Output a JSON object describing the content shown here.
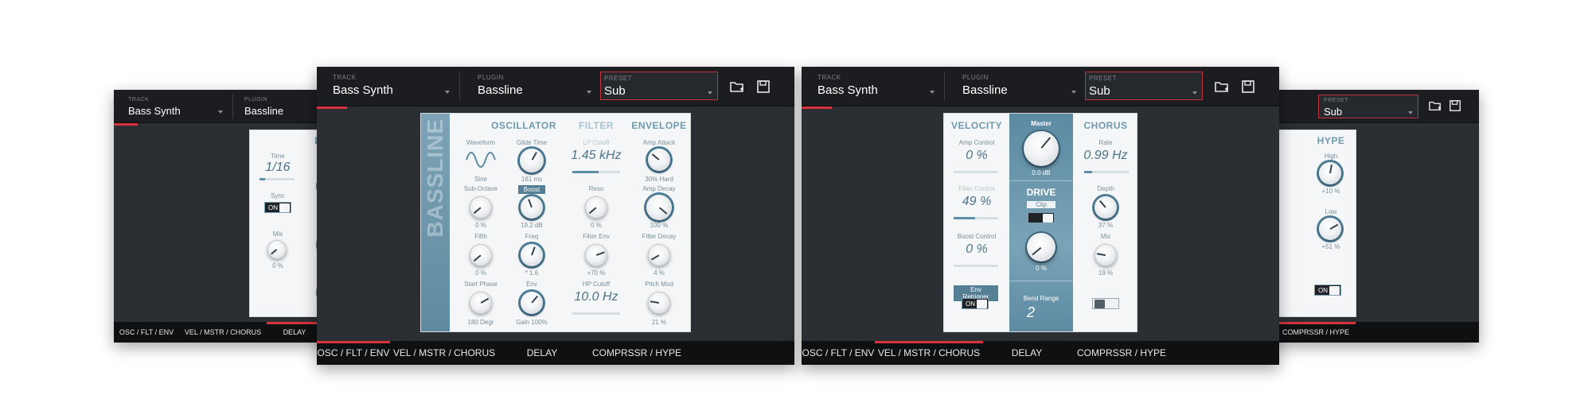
{
  "common": {
    "track_label": "TRACK",
    "plugin_label": "PLUGIN",
    "preset_label": "PRESET",
    "track_value": "Bass Synth",
    "plugin_value": "Bassline",
    "preset_value": "Sub",
    "accent_color": "#d8323c",
    "icons": [
      "folder-open-icon",
      "save-icon"
    ]
  },
  "tabs": [
    "OSC / FLT / ENV",
    "VEL / MSTR / CHORUS",
    "DELAY",
    "COMPRSSR / HYPE"
  ],
  "delay_panel": {
    "title": "DE",
    "time_label": "Time",
    "time_value": "1/16",
    "sync_label": "Sync",
    "sync_value": "ON",
    "mix_label": "Mix",
    "mix_value": "0 %"
  },
  "osc_panel": {
    "logo": "BASSLINE",
    "oscillator": {
      "title": "OSCILLATOR",
      "waveform_label": "Waveform",
      "waveform_value": "Sine",
      "glide_label": "Glide Time",
      "glide_value": "161 ms",
      "sub_octave_label": "Sub-Octave",
      "sub_octave_value": "0 %",
      "boost_label": "Boost",
      "boost_value": "19.2 dB",
      "fifth_label": "Fifth",
      "fifth_value": "0 %",
      "freq_label": "Freq",
      "freq_value": "* 1.6",
      "start_phase_label": "Start Phase",
      "start_phase_value": "180 Degr",
      "env_label": "Env",
      "env_value": "Gain 100%"
    },
    "filter": {
      "title": "FILTER",
      "lp_label": "LP Cutoff",
      "lp_value": "1.45 kHz",
      "reso_label": "Reso",
      "reso_value": "0 %",
      "filter_env_label": "Filter Env",
      "filter_env_value": "+70 %",
      "hp_label": "HP Cutoff",
      "hp_value": "10.0 Hz"
    },
    "envelope": {
      "title": "ENVELOPE",
      "amp_attack_label": "Amp Attack",
      "amp_attack_value": "30% Hard",
      "amp_decay_label": "Amp Decay",
      "amp_decay_value": "100 %",
      "filter_decay_label": "Filter Decay",
      "filter_decay_value": "4 %",
      "pitch_mod_label": "Pitch Mod",
      "pitch_mod_value": "21 %"
    }
  },
  "vel_panel": {
    "velocity": {
      "title": "VELOCITY",
      "amp_label": "Amp Control",
      "amp_value": "0 %",
      "filter_label": "Filter Control",
      "filter_value": "49 %",
      "boost_label": "Boost Control",
      "boost_value": "0 %",
      "retrigger_label": "Env Retrigger",
      "retrigger_value": "ON"
    },
    "master": {
      "title": "Master",
      "value": "0.0 dB"
    },
    "drive": {
      "title": "DRIVE",
      "clip_label": "Clip",
      "value": "0 %",
      "band_label": "Bend Range",
      "band_value": "2"
    },
    "chorus": {
      "title": "CHORUS",
      "rate_label": "Rate",
      "rate_value": "0.99 Hz",
      "depth_label": "Depth",
      "depth_value": "37 %",
      "mix_label": "Mix",
      "mix_value": "19 %"
    }
  },
  "hype_panel": {
    "title": "HYPE",
    "high_label": "High",
    "high_value": "+10 %",
    "low_label": "Low",
    "low_value": "+51 %",
    "toggle_value": "ON"
  }
}
